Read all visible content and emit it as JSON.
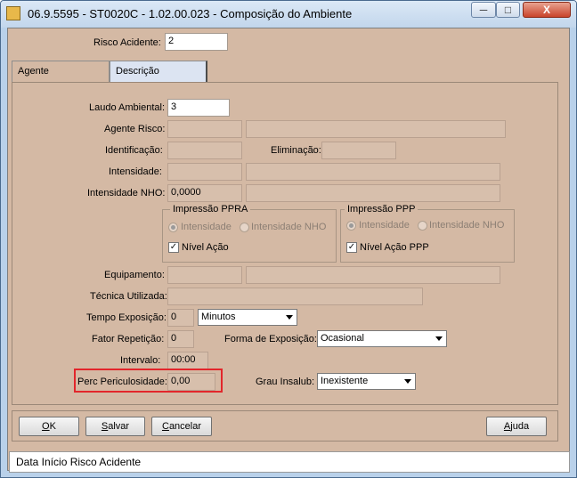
{
  "window": {
    "title": "06.9.5595 - ST0020C - 1.02.00.023 - Composição do Ambiente",
    "minimize_glyph": "─",
    "maximize_glyph": "□",
    "close_glyph": "X"
  },
  "header": {
    "risco_acidente_label": "Risco Acidente:",
    "risco_acidente_value": "2"
  },
  "tabs": [
    {
      "label": "Agente",
      "active": true
    },
    {
      "label": "Descrição",
      "active": false
    }
  ],
  "form": {
    "laudo_label": "Laudo Ambiental:",
    "laudo_value": "3",
    "agente_risco_label": "Agente Risco:",
    "agente_risco_code": "",
    "agente_risco_desc": "",
    "identificacao_label": "Identificação:",
    "identificacao_value": "",
    "eliminacao_label": "Eliminação:",
    "eliminacao_value": "",
    "intensidade_label": "Intensidade:",
    "intensidade_value": "",
    "intensidade_desc": "",
    "intensidade_nho_label": "Intensidade NHO:",
    "intensidade_nho_value": "0,0000",
    "intensidade_nho_desc": "",
    "impressao_ppra": {
      "title": "Impressão PPRA",
      "radio_intensidade": "Intensidade",
      "radio_intensidade_nho": "Intensidade NHO",
      "checkbox_label": "Nível Ação"
    },
    "impressao_ppp": {
      "title": "Impressão PPP",
      "radio_intensidade": "Intensidade",
      "radio_intensidade_nho": "Intensidade NHO",
      "checkbox_label": "Nível Ação PPP"
    },
    "check_glyph": "✓",
    "equipamento_label": "Equipamento:",
    "equipamento_code": "",
    "equipamento_desc": "",
    "tecnica_label": "Técnica Utilizada:",
    "tecnica_value": "",
    "tempo_label": "Tempo Exposição:",
    "tempo_value": "0",
    "tempo_unit": "Minutos",
    "fator_label": "Fator Repetição:",
    "fator_value": "0",
    "forma_label": "Forma de Exposição:",
    "forma_value": "Ocasional",
    "intervalo_label": "Intervalo:",
    "intervalo_value": "00:00",
    "perc_label": "Perc Periculosidade:",
    "perc_value": "0,00",
    "grau_label": "Grau Insalub:",
    "grau_value": "Inexistente"
  },
  "buttons": {
    "ok_u": "O",
    "ok_rest": "K",
    "salvar_u": "S",
    "salvar_rest": "alvar",
    "cancelar_u": "C",
    "cancelar_rest": "ancelar",
    "ajuda_u": "A",
    "ajuda_rest": "juda"
  },
  "status": {
    "text": "Data Início Risco Acidente"
  }
}
